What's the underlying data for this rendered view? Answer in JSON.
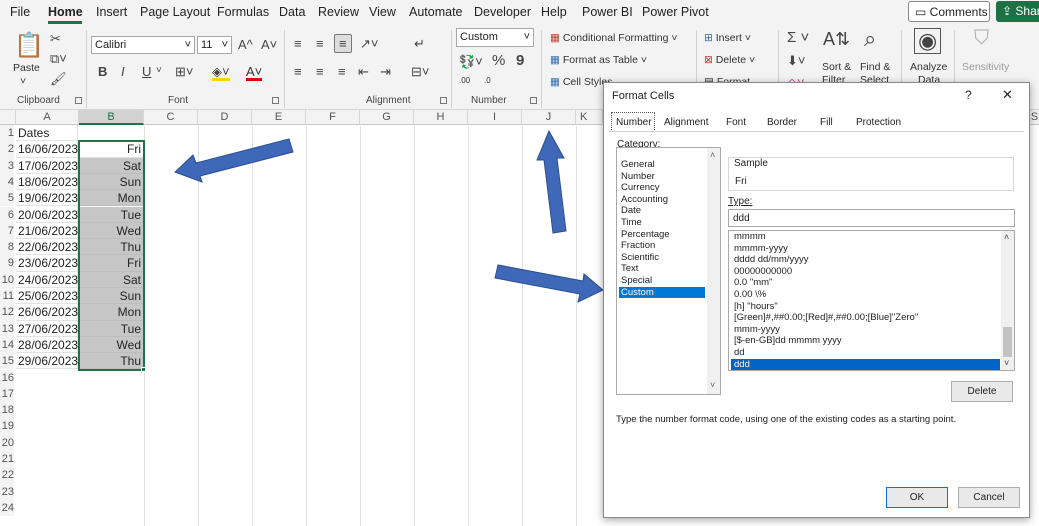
{
  "menu": {
    "items": [
      "File",
      "Home",
      "Insert",
      "Page Layout",
      "Formulas",
      "Data",
      "Review",
      "View",
      "Automate",
      "Developer",
      "Help",
      "Power BI",
      "Power Pivot"
    ],
    "active": "Home",
    "comments_label": "Comments",
    "share_label": "Shar"
  },
  "ribbon": {
    "clipboard": {
      "paste_label": "Paste",
      "group_label": "Clipboard"
    },
    "font": {
      "font_name": "Calibri",
      "font_size": "11",
      "group_label": "Font",
      "bold": "B",
      "italic": "I",
      "underline": "U",
      "grow": "A^",
      "shrink": "A˅",
      "font_color_glyph": "A"
    },
    "alignment": {
      "group_label": "Alignment"
    },
    "number": {
      "format_value": "Custom",
      "percent": "%",
      "comma": "9",
      "inc_decimal": ".00",
      "dec_decimal": ".0",
      "group_label": "Number"
    },
    "styles": {
      "conditional_formatting": "Conditional Formatting",
      "format_as_table": "Format as Table",
      "cell_styles": "Cell Styles"
    },
    "cells": {
      "insert": "Insert",
      "delete": "Delete",
      "format": "Format"
    },
    "editing": {
      "sort_filter": "Sort & Filter",
      "find_select": "Find & Select",
      "sort_line1": "Sort &",
      "sort_line2": "Filter",
      "find_line1": "Find &",
      "find_line2": "Select"
    },
    "analyze": {
      "label_line1": "Analyze",
      "label_line2": "Data"
    },
    "sensitivity": {
      "label": "Sensitivity"
    }
  },
  "sheet": {
    "columns": [
      "A",
      "B",
      "C",
      "D",
      "E",
      "F",
      "G",
      "H",
      "I",
      "J",
      "K",
      "S"
    ],
    "row_numbers": [
      "1",
      "2",
      "3",
      "4",
      "5",
      "6",
      "7",
      "8",
      "9",
      "10",
      "11",
      "12",
      "13",
      "14",
      "15",
      "16",
      "17",
      "18",
      "19",
      "20",
      "21",
      "22",
      "23",
      "24"
    ],
    "header_a": "Dates",
    "rows": [
      {
        "a": "16/06/2023",
        "b": "Fri"
      },
      {
        "a": "17/06/2023",
        "b": "Sat"
      },
      {
        "a": "18/06/2023",
        "b": "Sun"
      },
      {
        "a": "19/06/2023",
        "b": "Mon"
      },
      {
        "a": "20/06/2023",
        "b": "Tue"
      },
      {
        "a": "21/06/2023",
        "b": "Wed"
      },
      {
        "a": "22/06/2023",
        "b": "Thu"
      },
      {
        "a": "23/06/2023",
        "b": "Fri"
      },
      {
        "a": "24/06/2023",
        "b": "Sat"
      },
      {
        "a": "25/06/2023",
        "b": "Sun"
      },
      {
        "a": "26/06/2023",
        "b": "Mon"
      },
      {
        "a": "27/06/2023",
        "b": "Tue"
      },
      {
        "a": "28/06/2023",
        "b": "Wed"
      },
      {
        "a": "29/06/2023",
        "b": "Thu"
      }
    ]
  },
  "dialog": {
    "title": "Format Cells",
    "help": "?",
    "close": "✕",
    "tabs": [
      "Number",
      "Alignment",
      "Font",
      "Border",
      "Fill",
      "Protection"
    ],
    "active_tab": "Number",
    "category_label": "Category:",
    "categories": [
      "General",
      "Number",
      "Currency",
      "Accounting",
      "Date",
      "Time",
      "Percentage",
      "Fraction",
      "Scientific",
      "Text",
      "Special",
      "Custom"
    ],
    "selected_category": "Custom",
    "sample_label": "Sample",
    "sample_value": "Fri",
    "type_label": "Type:",
    "type_value": "ddd",
    "type_list": [
      "mmmm",
      "mmmm-yyyy",
      "dddd dd/mm/yyyy",
      "00000000000",
      "0.0 \"mm\"",
      "0.00 \\%",
      "[h] \"hours\"",
      "[Green]#,##0.00;[Red]#,##0.00;[Blue]\"Zero\"",
      "mmm-yyyy",
      "[$-en-GB]dd mmmm yyyy",
      "dd",
      "ddd"
    ],
    "selected_type": "ddd",
    "delete_label": "Delete",
    "hint": "Type the number format code, using one of the existing codes as a starting point.",
    "ok_label": "OK",
    "cancel_label": "Cancel"
  },
  "colors": {
    "accent_green": "#217346",
    "arrow_blue": "#3f68b8",
    "selection_blue": "#0078d7"
  }
}
